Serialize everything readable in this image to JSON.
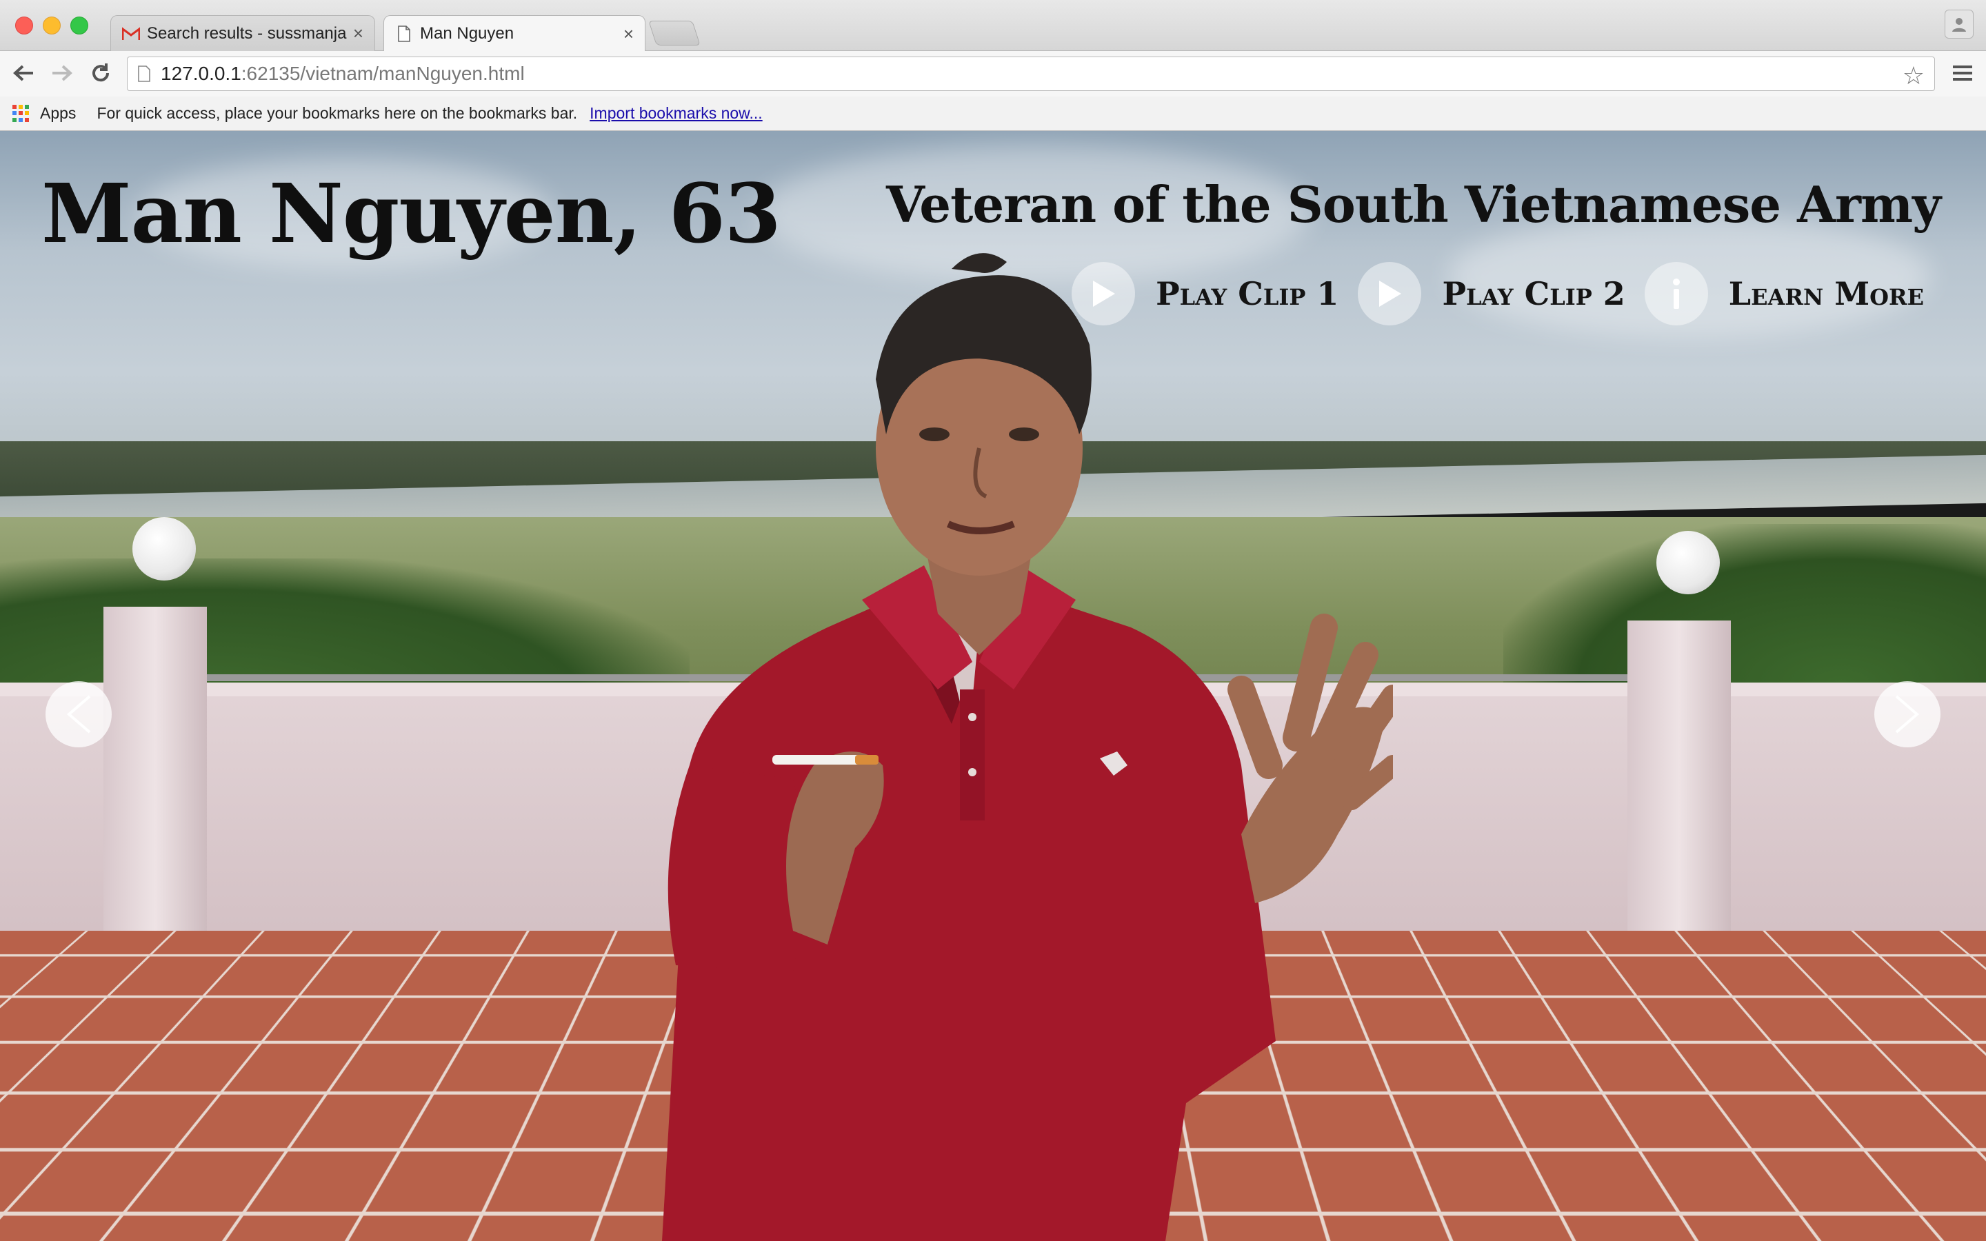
{
  "browser": {
    "tabs": [
      {
        "title": "Search results - sussmanja",
        "icon": "gmail-icon",
        "active": false
      },
      {
        "title": "Man Nguyen",
        "icon": "page-icon",
        "active": true
      }
    ],
    "url_host": "127.0.0.1",
    "url_rest": ":62135/vietnam/manNguyen.html",
    "bookmarks": {
      "apps_label": "Apps",
      "hint": "For quick access, place your bookmarks here on the bookmarks bar.",
      "import_link": "Import bookmarks now..."
    }
  },
  "page": {
    "name": "Man Nguyen, 63",
    "subtitle": "Veteran of the South Vietnamese Army",
    "controls": [
      {
        "label": "Play Clip 1",
        "icon": "play-icon"
      },
      {
        "label": "Play Clip 2",
        "icon": "play-icon"
      },
      {
        "label": "Learn More",
        "icon": "info-icon"
      }
    ],
    "nav": {
      "prev_icon": "chevron-left-icon",
      "next_icon": "chevron-right-icon"
    }
  },
  "colors": {
    "gmail_red": "#d93025",
    "apps_grid": [
      "#ea4335",
      "#fbbc04",
      "#34a853",
      "#4285f4"
    ],
    "shirt": "#a3182a",
    "link": "#1a0dab"
  }
}
